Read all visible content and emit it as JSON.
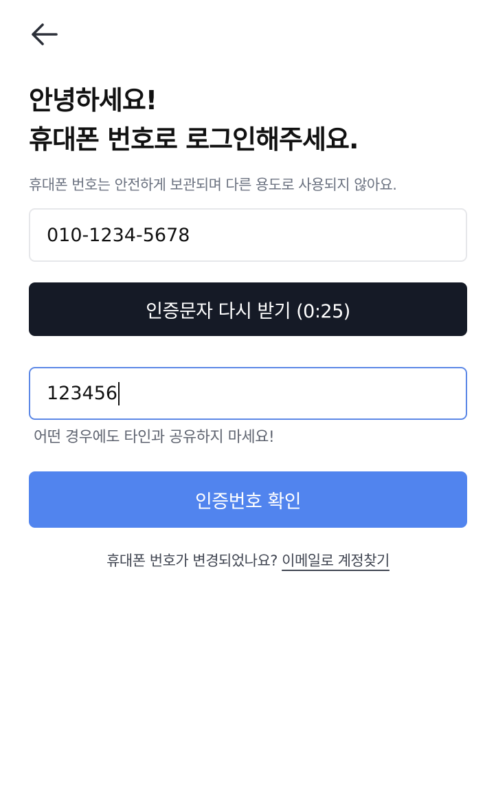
{
  "nav": {
    "back_icon": "arrow-left-icon"
  },
  "header": {
    "title_line1": "안녕하세요!",
    "title_line2": "휴대폰 번호로 로그인해주세요.",
    "subtitle": "휴대폰 번호는 안전하게 보관되며 다른 용도로 사용되지 않아요."
  },
  "phone": {
    "value": "010-1234-5678"
  },
  "resend": {
    "label": "인증문자 다시 받기 (0:25)"
  },
  "code": {
    "value": "123456",
    "hint": "어떤 경우에도 타인과 공유하지 마세요!"
  },
  "verify": {
    "label": "인증번호 확인"
  },
  "footer": {
    "question": "휴대폰 번호가 변경되었나요?",
    "link": "이메일로 계정찾기"
  },
  "colors": {
    "primary_dark": "#151a26",
    "primary_blue": "#5184ee",
    "focus_border": "#5b87e6",
    "muted_text": "#6b7280"
  }
}
